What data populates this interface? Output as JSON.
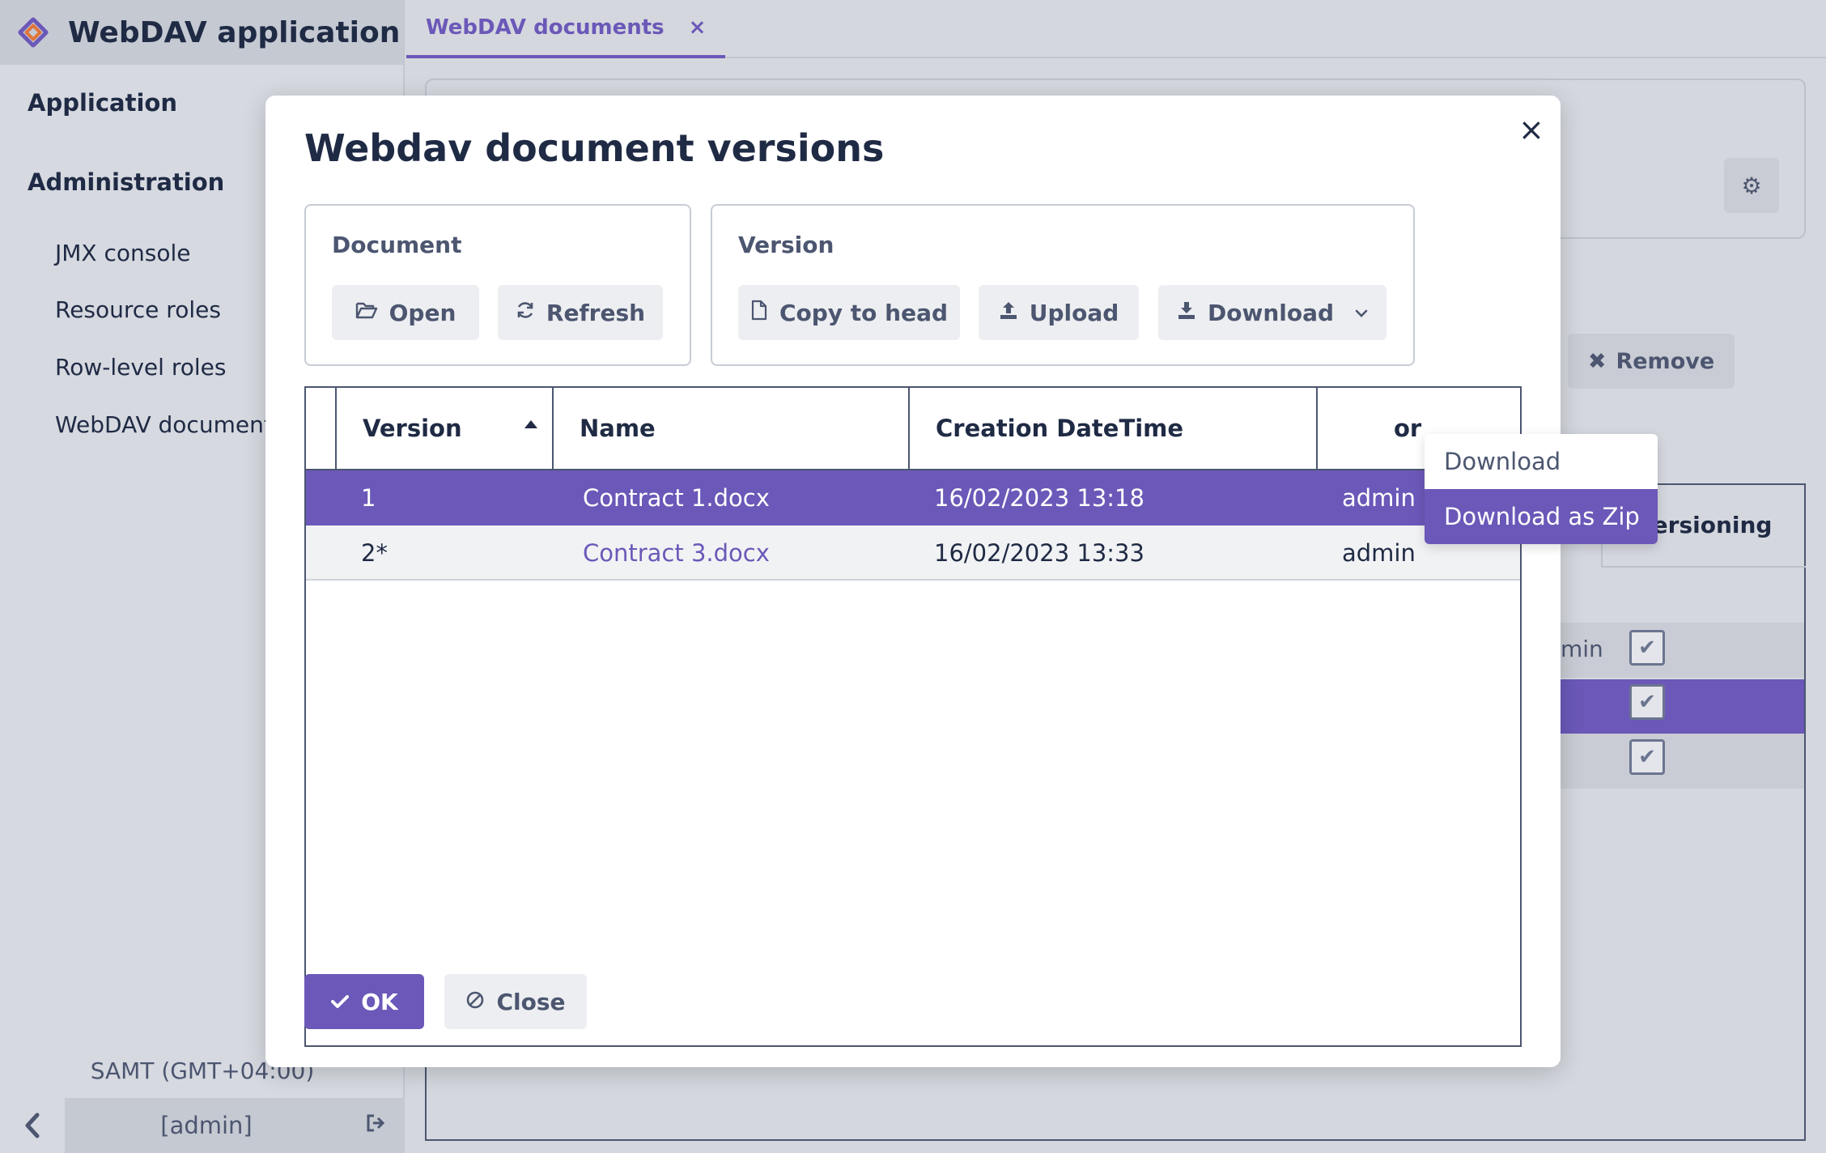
{
  "app": {
    "title": "WebDAV application"
  },
  "sidebar": {
    "sections": [
      {
        "label": "Application"
      },
      {
        "label": "Administration"
      }
    ],
    "items": [
      {
        "label": "JMX console"
      },
      {
        "label": "Resource roles"
      },
      {
        "label": "Row-level roles"
      },
      {
        "label": "WebDAV documents"
      }
    ],
    "timezone": "SAMT (GMT+04:00)",
    "user": "[admin]"
  },
  "tabs": [
    {
      "label": "WebDAV documents",
      "close": "×"
    }
  ],
  "background": {
    "remove_label": "Remove",
    "versioning_header": "Versioning",
    "row_fragment": "min"
  },
  "modal": {
    "title": "Webdav document versions",
    "close": "×",
    "document_group": {
      "title": "Document",
      "open_label": "Open",
      "refresh_label": "Refresh"
    },
    "version_group": {
      "title": "Version",
      "copy_label": "Copy to head",
      "upload_label": "Upload",
      "download_label": "Download"
    },
    "download_menu": [
      {
        "label": "Download"
      },
      {
        "label": "Download as Zip"
      }
    ],
    "table": {
      "columns": [
        "Version",
        "Name",
        "Creation DateTime",
        "or"
      ],
      "rows": [
        {
          "version": "1",
          "name": "Contract 1.docx",
          "created": "16/02/2023 13:18",
          "author": "admin"
        },
        {
          "version": "2*",
          "name": "Contract 3.docx",
          "created": "16/02/2023 13:33",
          "author": "admin"
        }
      ]
    },
    "ok_label": "OK",
    "close_label": "Close"
  },
  "colors": {
    "accent": "#6b58b8",
    "text": "#1f2a44",
    "muted": "#4c5670",
    "backdrop": "#d4d7de"
  }
}
